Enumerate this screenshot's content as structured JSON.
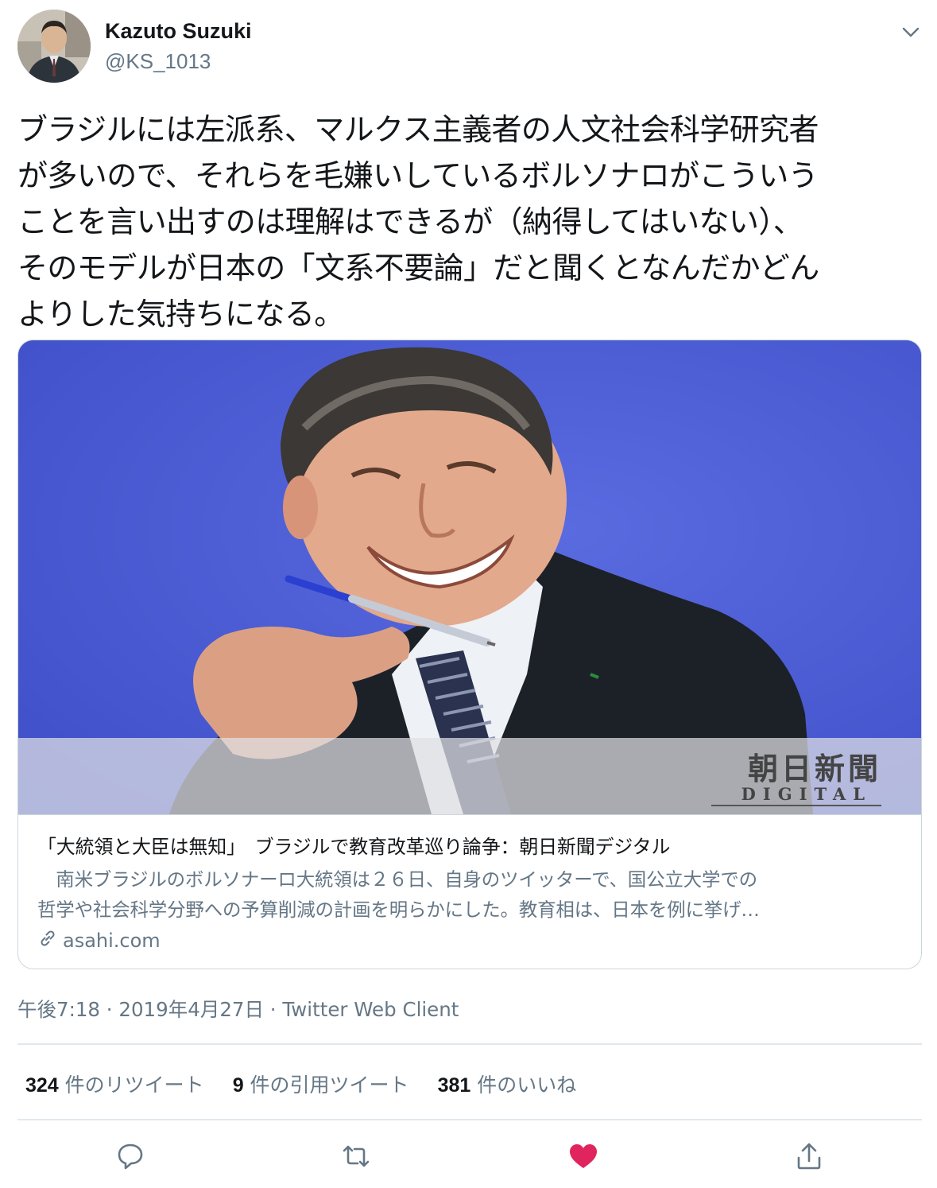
{
  "author": {
    "name": "Kazuto Suzuki",
    "handle": "@KS_1013"
  },
  "tweet": {
    "lines": [
      "ブラジルには左派系、マルクス主義者の人文社会科学研究者",
      "が多いので、それらを毛嫌いしているボルソナロがこういう",
      "ことを言い出すのは理解はできるが（納得してはいない）、",
      "そのモデルが日本の「文系不要論」だと聞くとなんだかどん",
      "よりした気持ちになる。"
    ]
  },
  "card": {
    "logo_main": "朝日新聞",
    "logo_sub": "DIGITAL",
    "title": "「大統領と大臣は無知」　ブラジルで教育改革巡り論争：朝日新聞デジタル",
    "desc_lines": [
      "　南米ブラジルのボルソナーロ大統領は２６日、自身のツイッターで、国公立大学での",
      "哲学や社会科学分野への予算削減の計画を明らかにした。教育相は、日本を例に挙げ…"
    ],
    "domain": "asahi.com"
  },
  "meta": {
    "text": "午後7:18 · 2019年4月27日 · Twitter Web Client"
  },
  "stats": {
    "retweets_count": "324",
    "retweets_label": "件のリツイート",
    "quotes_count": "9",
    "quotes_label": "件の引用ツイート",
    "likes_count": "381",
    "likes_label": "件のいいね"
  },
  "colors": {
    "like_active": "#e0245e",
    "icon_gray": "#657786",
    "image_bg": "#4b5bd6"
  },
  "icons": [
    "chevron-down-icon",
    "link-icon",
    "reply-icon",
    "retweet-icon",
    "heart-icon",
    "share-icon"
  ]
}
